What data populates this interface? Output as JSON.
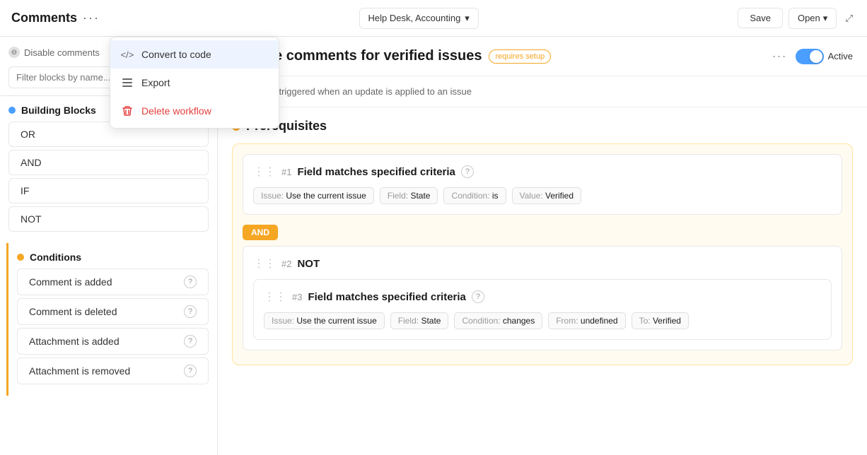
{
  "header": {
    "title": "Comments",
    "dots_label": "···",
    "workspace": "Help Desk, Accounting",
    "save_label": "Save",
    "open_label": "Open",
    "chevron": "▾",
    "expand_icon": "⤢"
  },
  "dropdown": {
    "items": [
      {
        "id": "convert",
        "label": "Convert to code",
        "icon": "</>",
        "highlighted": true
      },
      {
        "id": "export",
        "label": "Export",
        "icon": "▤",
        "highlighted": false
      },
      {
        "id": "delete",
        "label": "Delete workflow",
        "icon": "🗑",
        "highlighted": false,
        "danger": true
      }
    ]
  },
  "sidebar": {
    "disable_btn": "Disable comments",
    "filter_placeholder": "Filter blocks by name...",
    "building_blocks": {
      "title": "Building Blocks",
      "items": [
        "OR",
        "AND",
        "IF",
        "NOT"
      ]
    },
    "conditions": {
      "title": "Conditions",
      "items": [
        {
          "label": "Comment is added",
          "has_help": true
        },
        {
          "label": "Comment is deleted",
          "has_help": true
        },
        {
          "label": "Attachment is added",
          "has_help": true
        },
        {
          "label": "Attachment is removed",
          "has_help": true
        }
      ]
    }
  },
  "content": {
    "title": "able comments for verified issues",
    "title_prefix": "Dis",
    "full_title": "Disable comments for verified issues",
    "requires_setup": "requires setup",
    "more_icon": "···",
    "toggle_label": "Active",
    "rule_description": "This rule is triggered when an update is applied to an issue",
    "prerequisites_title": "Prerequisites",
    "block1": {
      "number": "#1",
      "title": "Field matches specified criteria",
      "tags": [
        {
          "label": "Issue:",
          "value": "Use the current issue"
        },
        {
          "label": "Field:",
          "value": "State"
        },
        {
          "label": "Condition:",
          "value": "is"
        },
        {
          "label": "Value:",
          "value": "Verified"
        }
      ]
    },
    "and_badge": "AND",
    "block2": {
      "number": "#2",
      "title": "NOT"
    },
    "block3": {
      "number": "#3",
      "title": "Field matches specified criteria",
      "tags": [
        {
          "label": "Issue:",
          "value": "Use the current issue"
        },
        {
          "label": "Field:",
          "value": "State"
        },
        {
          "label": "Condition:",
          "value": "changes"
        },
        {
          "label": "From:",
          "value": "undefined"
        },
        {
          "label": "To:",
          "value": "Verified"
        }
      ]
    }
  }
}
